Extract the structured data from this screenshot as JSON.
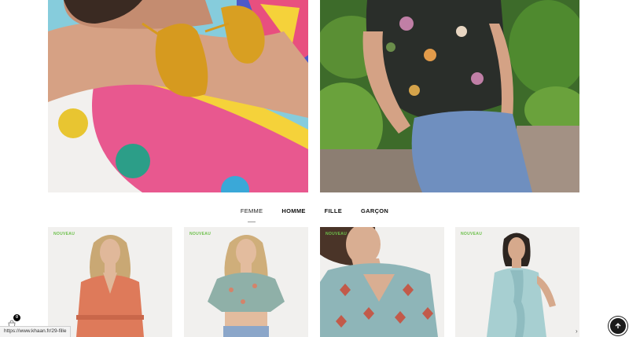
{
  "tabs": [
    {
      "label": "FEMME",
      "active": true
    },
    {
      "label": "HOMME",
      "active": false
    },
    {
      "label": "FILLE",
      "active": false
    },
    {
      "label": "GARÇON",
      "active": false
    }
  ],
  "products": [
    {
      "badge": "NOUVEAU"
    },
    {
      "badge": "NOUVEAU"
    },
    {
      "badge": "NOUVEAU"
    },
    {
      "badge": "NOUVEAU"
    }
  ],
  "status_bar": {
    "url": "https://www.khaan.fr/29-fille"
  },
  "cart": {
    "count": "0",
    "icon": "shopping-bag-icon"
  },
  "scroll_top": {
    "icon": "arrow-up-icon"
  },
  "colors": {
    "badge_green": "#6cc04a",
    "dark": "#1b1b1b"
  }
}
